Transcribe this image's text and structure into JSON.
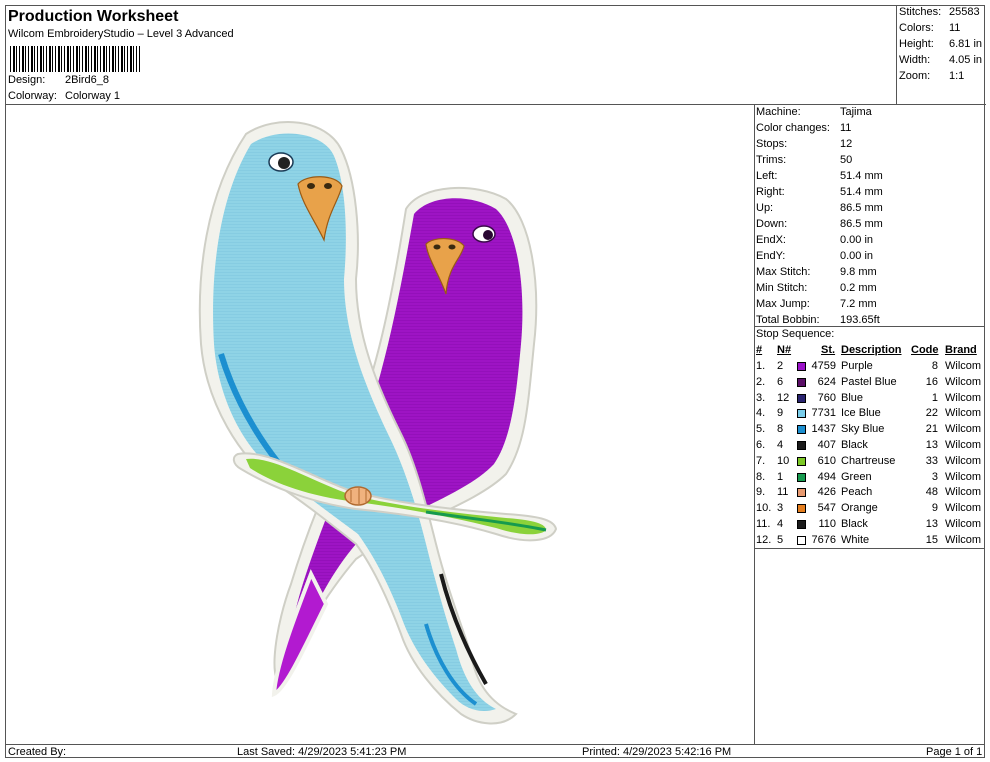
{
  "header": {
    "title": "Production Worksheet",
    "software": "Wilcom EmbroideryStudio – Level 3 Advanced",
    "design_label": "Design:",
    "design_value": "2Bird6_8",
    "colorway_label": "Colorway:",
    "colorway_value": "Colorway 1"
  },
  "stats": [
    {
      "label": "Stitches:",
      "value": "25583"
    },
    {
      "label": "Colors:",
      "value": "11"
    },
    {
      "label": "Height:",
      "value": "6.81 in"
    },
    {
      "label": "Width:",
      "value": "4.05 in"
    },
    {
      "label": "Zoom:",
      "value": "1:1"
    }
  ],
  "machine_info": [
    {
      "label": "Machine:",
      "value": "Tajima"
    },
    {
      "label": "Color changes:",
      "value": "11"
    },
    {
      "label": "Stops:",
      "value": "12"
    },
    {
      "label": "Trims:",
      "value": "50"
    },
    {
      "label": "Left:",
      "value": "51.4 mm"
    },
    {
      "label": "Right:",
      "value": "51.4 mm"
    },
    {
      "label": "Up:",
      "value": "86.5 mm"
    },
    {
      "label": "Down:",
      "value": "86.5 mm"
    },
    {
      "label": "EndX:",
      "value": "0.00 in"
    },
    {
      "label": "EndY:",
      "value": "0.00 in"
    },
    {
      "label": "Max Stitch:",
      "value": "9.8 mm"
    },
    {
      "label": "Min Stitch:",
      "value": "0.2 mm"
    },
    {
      "label": "Max Jump:",
      "value": "7.2 mm"
    },
    {
      "label": "Total Bobbin:",
      "value": "193.65ft"
    }
  ],
  "stop_sequence": {
    "title": "Stop Sequence:",
    "columns": [
      "#",
      "N#",
      "St.",
      "Description",
      "Code",
      "Brand"
    ],
    "rows": [
      {
        "num": "1.",
        "n": "2",
        "st": "4759",
        "desc": "Purple",
        "code": "8",
        "brand": "Wilcom",
        "color": "#9b12c9"
      },
      {
        "num": "2.",
        "n": "6",
        "st": "624",
        "desc": "Pastel Blue",
        "code": "16",
        "brand": "Wilcom",
        "color": "#5a0e66"
      },
      {
        "num": "3.",
        "n": "12",
        "st": "760",
        "desc": "Blue",
        "code": "1",
        "brand": "Wilcom",
        "color": "#2a2470"
      },
      {
        "num": "4.",
        "n": "9",
        "st": "7731",
        "desc": "Ice Blue",
        "code": "22",
        "brand": "Wilcom",
        "color": "#79cdea"
      },
      {
        "num": "5.",
        "n": "8",
        "st": "1437",
        "desc": "Sky Blue",
        "code": "21",
        "brand": "Wilcom",
        "color": "#1c8fd0"
      },
      {
        "num": "6.",
        "n": "4",
        "st": "407",
        "desc": "Black",
        "code": "13",
        "brand": "Wilcom",
        "color": "#1a1a1a"
      },
      {
        "num": "7.",
        "n": "10",
        "st": "610",
        "desc": "Chartreuse",
        "code": "33",
        "brand": "Wilcom",
        "color": "#7cc826"
      },
      {
        "num": "8.",
        "n": "1",
        "st": "494",
        "desc": "Green",
        "code": "3",
        "brand": "Wilcom",
        "color": "#169a4e"
      },
      {
        "num": "9.",
        "n": "11",
        "st": "426",
        "desc": "Peach",
        "code": "48",
        "brand": "Wilcom",
        "color": "#e89a70"
      },
      {
        "num": "10.",
        "n": "3",
        "st": "547",
        "desc": "Orange",
        "code": "9",
        "brand": "Wilcom",
        "color": "#e57e1e"
      },
      {
        "num": "11.",
        "n": "4",
        "st": "110",
        "desc": "Black",
        "code": "13",
        "brand": "Wilcom",
        "color": "#1a1a1a"
      },
      {
        "num": "12.",
        "n": "5",
        "st": "7676",
        "desc": "White",
        "code": "15",
        "brand": "Wilcom",
        "color": "#ffffff"
      }
    ]
  },
  "footer": {
    "created_by": "Created By:",
    "last_saved": "Last Saved: 4/29/2023 5:41:23 PM",
    "printed": "Printed: 4/29/2023 5:42:16 PM",
    "page": "Page 1 of 1"
  }
}
